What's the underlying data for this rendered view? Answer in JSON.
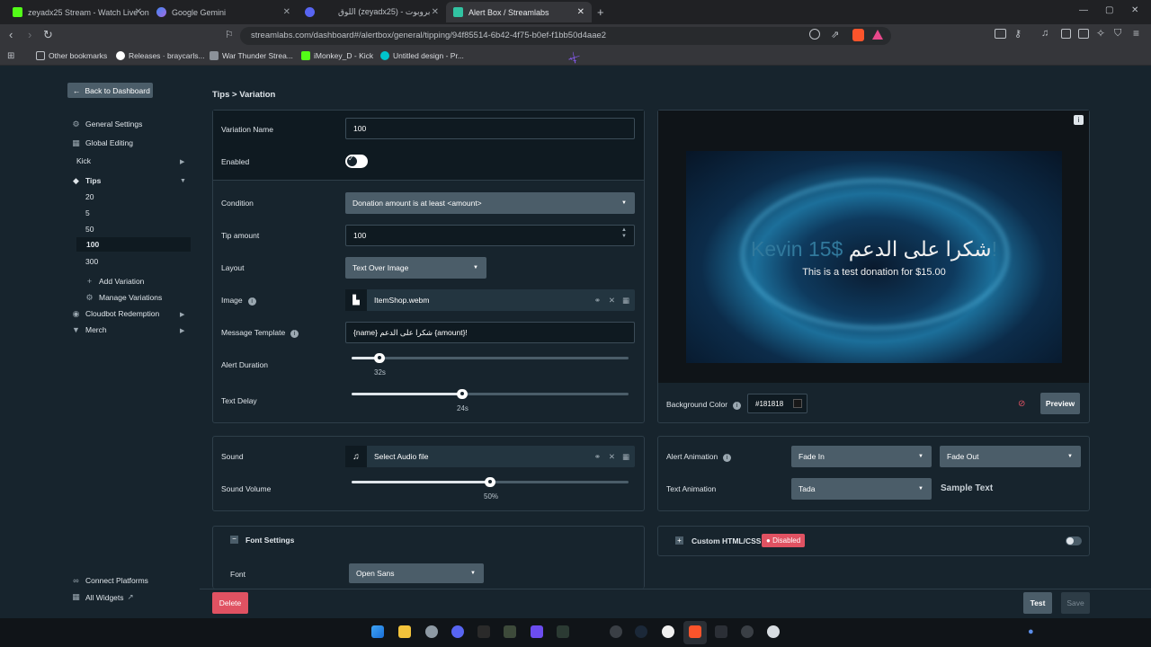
{
  "browser": {
    "tabs": [
      {
        "label": "zeyadx25 Stream - Watch Live on",
        "color": "#53fc18"
      },
      {
        "label": "Google Gemini",
        "color": "#8e7cf0"
      },
      {
        "label": "اللوق (zeyadx25) - بروبوت",
        "color": "#5865f2"
      },
      {
        "label": "Alert Box / Streamlabs",
        "color": "#31c3a2"
      }
    ],
    "new_tab": "+",
    "url": "streamlabs.com/dashboard#/alertbox/general/tipping/94f85514-6b42-4f75-b0ef-f1bb50d4aae2",
    "bookmarks": [
      "Other bookmarks",
      "Releases · braycarls...",
      "War Thunder Strea...",
      "iMonkey_D - Kick",
      "Untitled design - Pr..."
    ]
  },
  "sidebar": {
    "back": "Back to Dashboard",
    "items": [
      {
        "label": "General Settings"
      },
      {
        "label": "Global Editing"
      },
      {
        "label": "Kick"
      },
      {
        "label": "Tips"
      }
    ],
    "tips_sub": [
      "20",
      "5",
      "50",
      "100",
      "300"
    ],
    "add_variation": "Add Variation",
    "manage_variations": "Manage Variations",
    "cloudbot": "Cloudbot Redemption",
    "merch": "Merch",
    "connect": "Connect Platforms",
    "all_widgets": "All Widgets"
  },
  "breadcrumb": {
    "parent": "Tips",
    "sep": ">",
    "current": "Variation"
  },
  "form": {
    "variation_name_label": "Variation Name",
    "variation_name": "100",
    "enabled_label": "Enabled",
    "enabled": true,
    "condition_label": "Condition",
    "condition": "Donation amount is at least <amount>",
    "tip_amount_label": "Tip amount",
    "tip_amount": "100",
    "layout_label": "Layout",
    "layout": "Text Over Image",
    "image_label": "Image",
    "image_file": "ItemShop.webm",
    "message_label": "Message Template",
    "message": "{name} شكرا على الدعم {amount}!",
    "alert_duration_label": "Alert Duration",
    "alert_duration": "32s",
    "alert_duration_fraction": 0.1,
    "text_delay_label": "Text Delay",
    "text_delay": "24s",
    "text_delay_fraction": 0.4
  },
  "sound": {
    "sound_label": "Sound",
    "file": "Select Audio file",
    "volume_label": "Sound Volume",
    "volume": "50%",
    "volume_fraction": 0.5
  },
  "font": {
    "section": "Font Settings",
    "font_label": "Font",
    "font": "Open Sans"
  },
  "preview": {
    "name": "Kevin",
    "arabic": "شكرا على الدعم",
    "amount": "$15!",
    "sub": "This is a test donation for $15.00",
    "bg_label": "Background Color",
    "bg_value": "#181818",
    "preview_btn": "Preview"
  },
  "animation": {
    "alert_label": "Alert Animation",
    "alert_in": "Fade In",
    "alert_out": "Fade Out",
    "text_label": "Text Animation",
    "text_anim": "Tada",
    "sample": "Sample Text"
  },
  "custom": {
    "label": "Custom HTML/CSS",
    "badge": "Disabled"
  },
  "footer": {
    "delete": "Delete",
    "test": "Test",
    "save": "Save"
  },
  "colors": {
    "accent": "#31c3a2",
    "danger": "#e05262",
    "panel_border": "#2e3e49"
  }
}
